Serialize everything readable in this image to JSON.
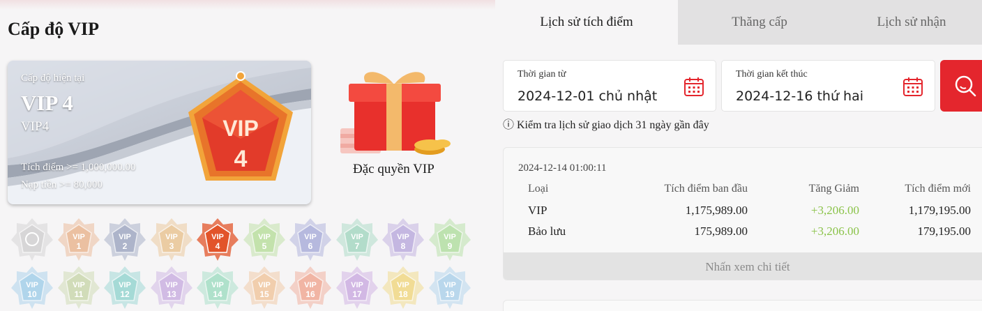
{
  "page": {
    "title": "Cấp độ VIP"
  },
  "vip_card": {
    "current_label": "Cấp độ hiện tại",
    "level_title": "VIP 4",
    "level_code": "VIP4",
    "points_req": "Tích điểm >= 1,000,000.00",
    "deposit_req": "Nạp tiền >= 80,000",
    "badge_text": "VIP",
    "badge_num": "4"
  },
  "privilege": {
    "label": "Đặc quyền VIP"
  },
  "badges": {
    "text": "VIP",
    "items": [
      {
        "num": "",
        "color": "#cfcfcf"
      },
      {
        "num": "1",
        "color": "#e8b28a"
      },
      {
        "num": "2",
        "color": "#9aa3bf"
      },
      {
        "num": "3",
        "color": "#e8c28c"
      },
      {
        "num": "4",
        "color": "#e2542a"
      },
      {
        "num": "5",
        "color": "#b5dd98"
      },
      {
        "num": "6",
        "color": "#a5a9d8"
      },
      {
        "num": "7",
        "color": "#9fd6be"
      },
      {
        "num": "8",
        "color": "#b7a6dc"
      },
      {
        "num": "9",
        "color": "#aedd9c"
      },
      {
        "num": "10",
        "color": "#9dcde8"
      },
      {
        "num": "11",
        "color": "#c8d6a9"
      },
      {
        "num": "12",
        "color": "#8fd3ce"
      },
      {
        "num": "13",
        "color": "#c8ace0"
      },
      {
        "num": "14",
        "color": "#9cdcc0"
      },
      {
        "num": "15",
        "color": "#f0c49a"
      },
      {
        "num": "16",
        "color": "#f0a48e"
      },
      {
        "num": "17",
        "color": "#c9a8e0"
      },
      {
        "num": "18",
        "color": "#f0d67a"
      },
      {
        "num": "19",
        "color": "#a8d0ea"
      }
    ]
  },
  "tabs": [
    {
      "label": "Lịch sử tích điểm"
    },
    {
      "label": "Thăng cấp"
    },
    {
      "label": "Lịch sử nhận"
    }
  ],
  "filter": {
    "from_label": "Thời gian từ",
    "from_value": "2024-12-01 chủ nhật",
    "to_label": "Thời gian kết thúc",
    "to_value": "2024-12-16 thứ hai",
    "note": "ⓘ Kiểm tra lịch sử giao dịch 31 ngày gần đây"
  },
  "record": {
    "datetime": "2024-12-14 01:00:11",
    "headers": [
      "Loại",
      "Tích điểm ban đầu",
      "Tăng Giảm",
      "Tích điểm mới"
    ],
    "rows": [
      [
        "VIP",
        "1,175,989.00",
        "+3,206.00",
        "1,179,195.00"
      ],
      [
        "Bảo lưu",
        "175,989.00",
        "+3,206.00",
        "179,195.00"
      ]
    ],
    "detail_label": "Nhấn xem chi tiết"
  },
  "colors": {
    "accent": "#e4262d",
    "increase": "#8bc34a"
  }
}
